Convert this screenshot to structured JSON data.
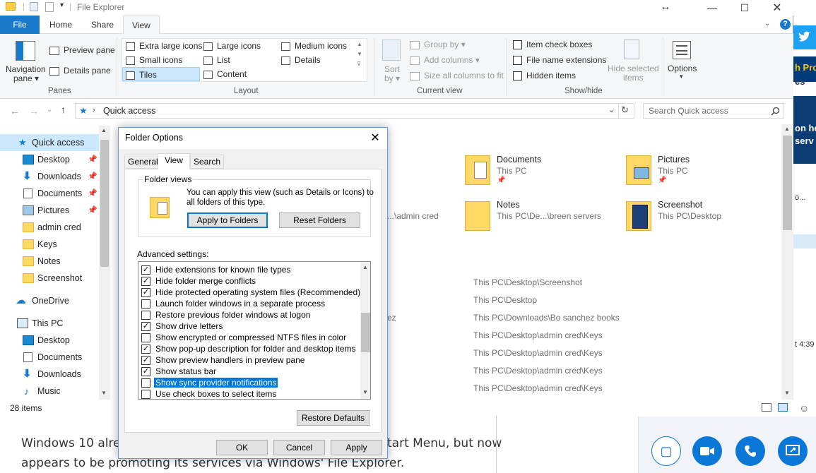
{
  "article": {
    "line1_left": "Windows 10 alrea",
    "line1_right": "tart Menu, but now",
    "line2": "appears to be promoting its services via Windows' File Explorer."
  },
  "skype": {
    "partial1": "h Pro",
    "partial2": "es",
    "partial3": "on he",
    "partial4": "serv",
    "partial5": "o...",
    "partial6": "t 4:39"
  },
  "window": {
    "title": "File Explorer"
  },
  "tabs": {
    "file": "File",
    "home": "Home",
    "share": "Share",
    "view": "View"
  },
  "panes": {
    "navigation": "Navigation",
    "navigation2": "pane",
    "preview": "Preview pane",
    "details": "Details pane",
    "group": "Panes"
  },
  "layout": {
    "extra_large": "Extra large icons",
    "large": "Large icons",
    "medium": "Medium icons",
    "small": "Small icons",
    "list": "List",
    "details": "Details",
    "tiles": "Tiles",
    "content": "Content",
    "group": "Layout"
  },
  "current_view": {
    "sort1": "Sort",
    "sort2": "by",
    "group_by": "Group by",
    "add_columns": "Add columns",
    "size_columns": "Size all columns to fit",
    "group": "Current view"
  },
  "show_hide": {
    "item_check": "Item check boxes",
    "file_ext": "File name extensions",
    "hidden": "Hidden items",
    "hide_selected1": "Hide selected",
    "hide_selected2": "items",
    "options": "Options",
    "group": "Show/hide"
  },
  "address": {
    "location": "Quick access",
    "search_placeholder": "Search Quick access"
  },
  "nav": {
    "quick_access": "Quick access",
    "items": [
      "Desktop",
      "Downloads",
      "Documents",
      "Pictures",
      "admin cred",
      "Keys",
      "Notes",
      "Screenshot"
    ],
    "onedrive": "OneDrive",
    "this_pc": "This PC",
    "pc_items": [
      "Desktop",
      "Documents",
      "Downloads",
      "Music"
    ]
  },
  "tiles": [
    {
      "name": "Documents",
      "sub": "This PC"
    },
    {
      "name": "Pictures",
      "sub": "This PC"
    },
    {
      "name": "Notes",
      "sub": "This PC\\De...\\breen servers"
    },
    {
      "name": "Screenshot",
      "sub": "This PC\\Desktop"
    }
  ],
  "tile_partial": "...\\admin cred",
  "recent_partial": "ez",
  "recent_paths": [
    "This PC\\Desktop\\Screenshot",
    "This PC\\Desktop",
    "This PC\\Downloads\\Bo sanchez books",
    "This PC\\Desktop\\admin cred\\Keys",
    "This PC\\Desktop\\admin cred\\Keys",
    "This PC\\Desktop\\admin cred\\Keys",
    "This PC\\Desktop\\admin cred\\Keys"
  ],
  "status": {
    "items": "28 items"
  },
  "dialog": {
    "title": "Folder Options",
    "tabs": [
      "General",
      "View",
      "Search"
    ],
    "folder_views_label": "Folder views",
    "folder_views_text1": "You can apply this view (such as Details or Icons) to",
    "folder_views_text2": "all folders of this type.",
    "apply_folders": "Apply to Folders",
    "reset_folders": "Reset Folders",
    "advanced_label": "Advanced settings:",
    "advanced": [
      {
        "label": "Hide extensions for known file types",
        "checked": true
      },
      {
        "label": "Hide folder merge conflicts",
        "checked": true
      },
      {
        "label": "Hide protected operating system files (Recommended)",
        "checked": true
      },
      {
        "label": "Launch folder windows in a separate process",
        "checked": false
      },
      {
        "label": "Restore previous folder windows at logon",
        "checked": false
      },
      {
        "label": "Show drive letters",
        "checked": true
      },
      {
        "label": "Show encrypted or compressed NTFS files in color",
        "checked": false
      },
      {
        "label": "Show pop-up description for folder and desktop items",
        "checked": true
      },
      {
        "label": "Show preview handlers in preview pane",
        "checked": true
      },
      {
        "label": "Show status bar",
        "checked": true
      },
      {
        "label": "Show sync provider notifications",
        "checked": false
      },
      {
        "label": "Use check boxes to select items",
        "checked": false
      }
    ],
    "restore_defaults": "Restore Defaults",
    "ok": "OK",
    "cancel": "Cancel",
    "apply": "Apply"
  },
  "colors": {
    "accent": "#0078d7",
    "file_tab": "#1979ca",
    "selection": "#cce8ff",
    "skype": "#0b78d7"
  }
}
